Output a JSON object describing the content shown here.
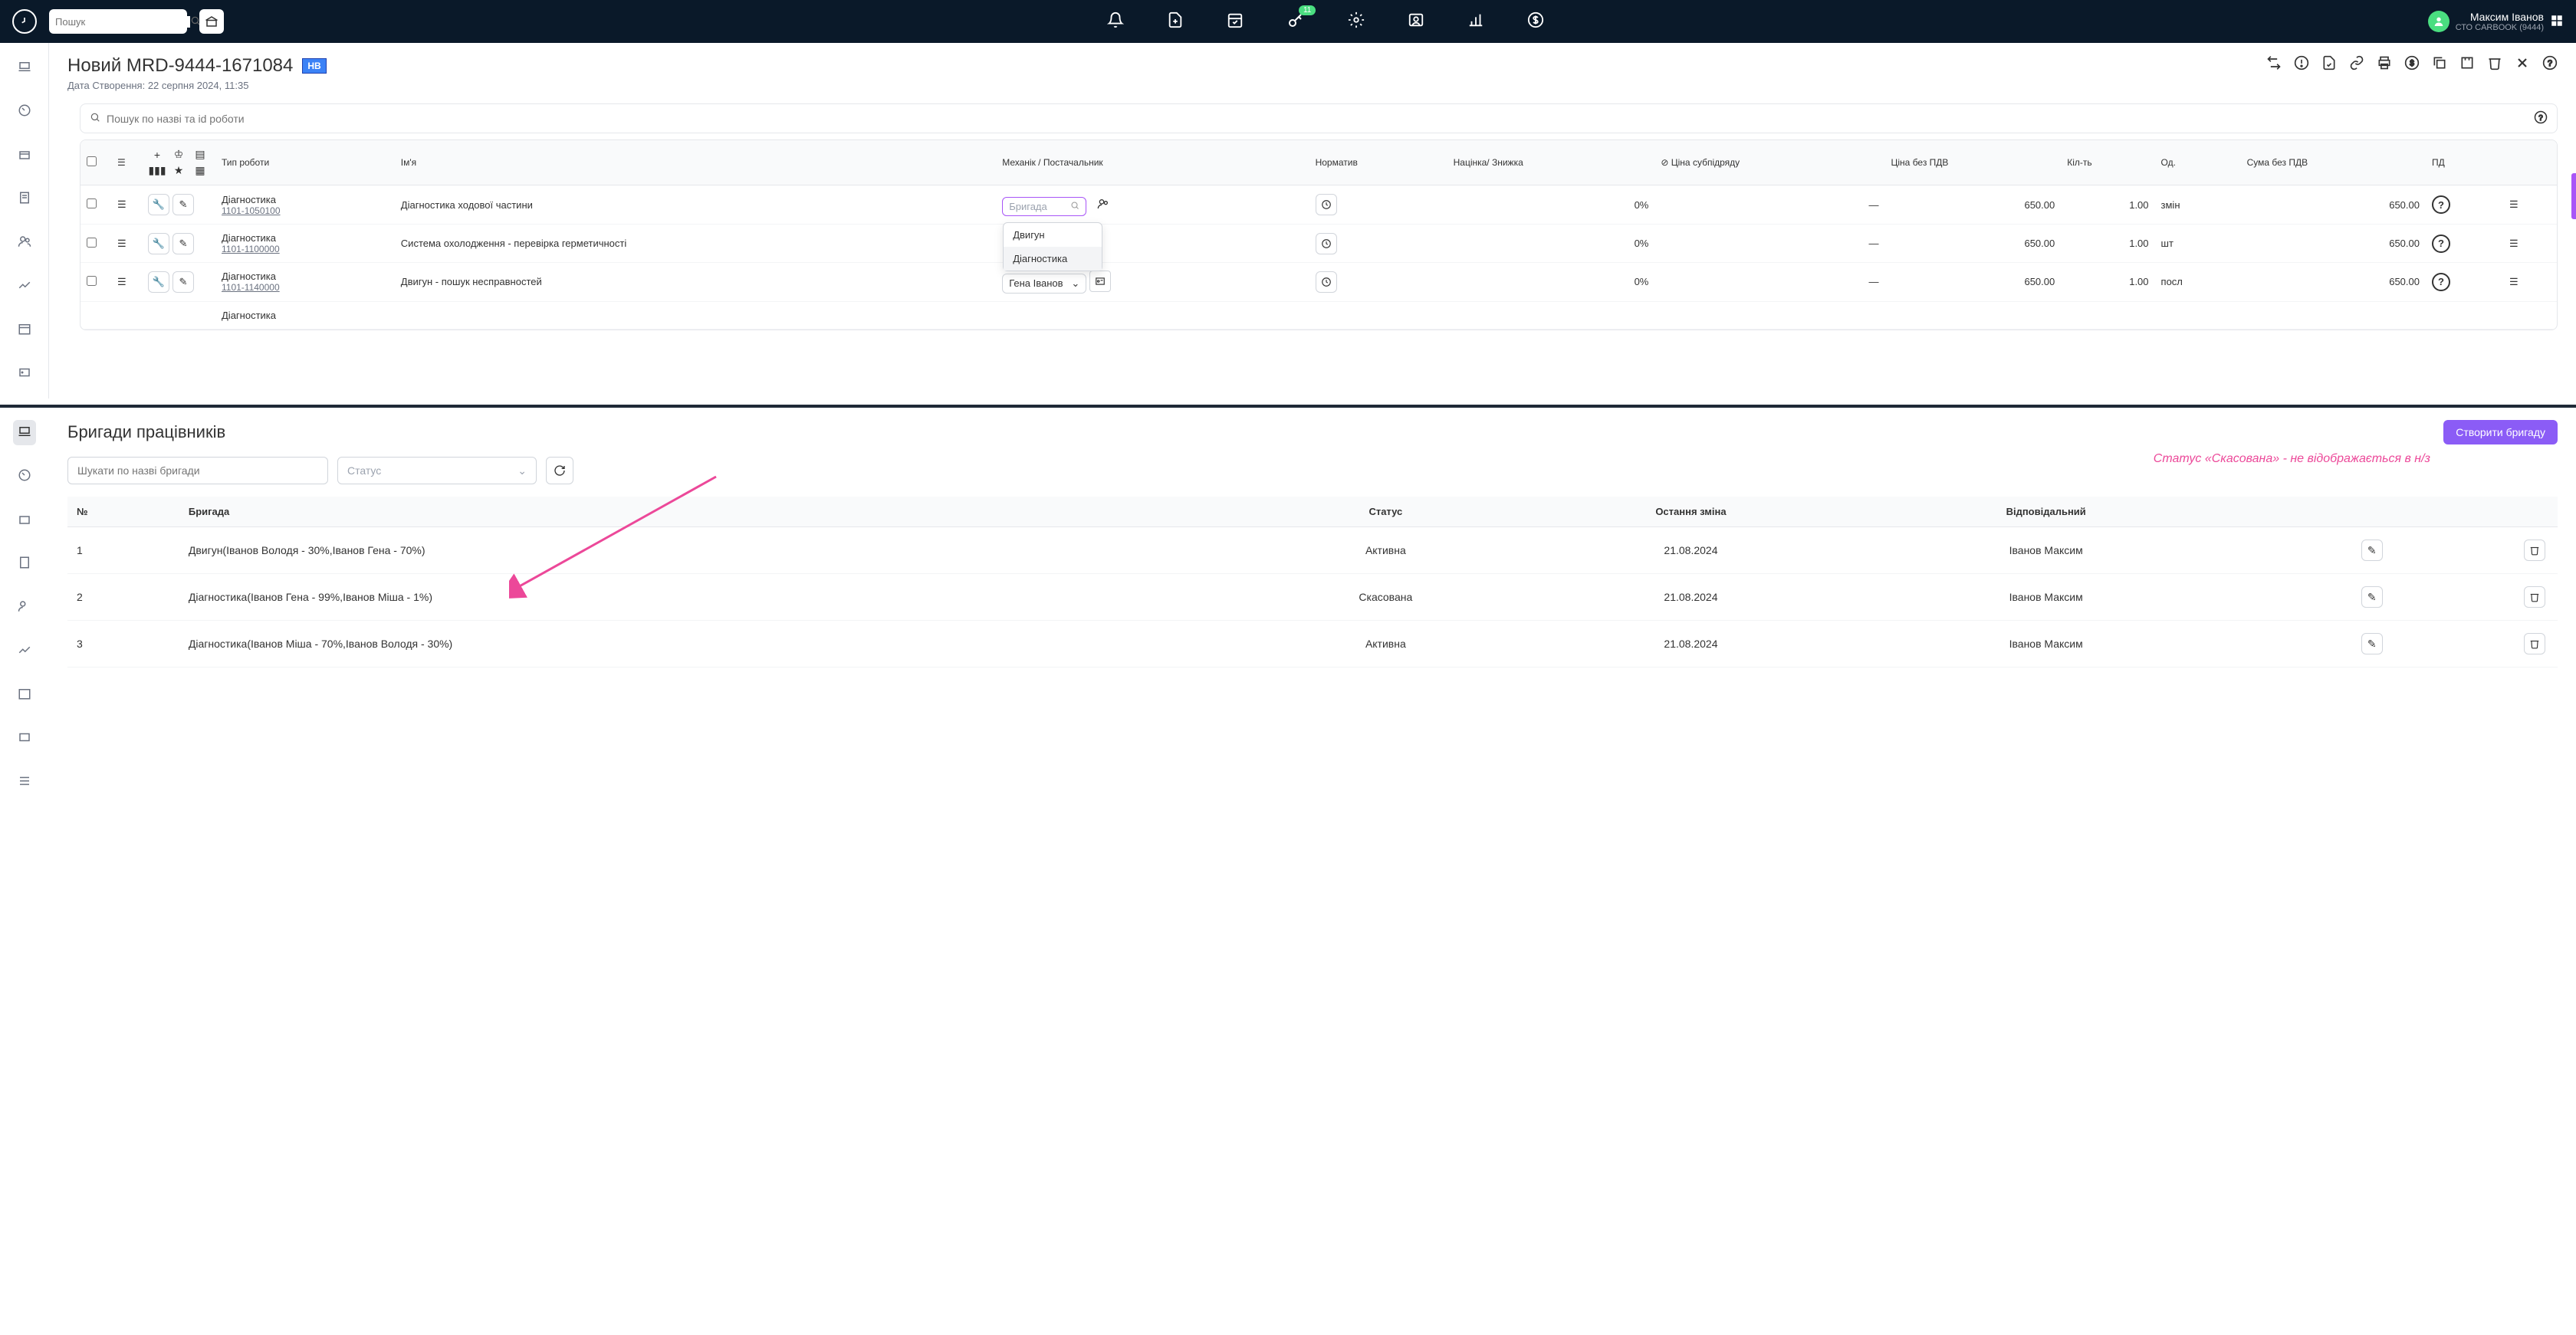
{
  "topbar": {
    "search_placeholder": "Пошук",
    "badge": "11"
  },
  "user": {
    "name": "Максим Іванов",
    "sub": "СТО CARBOOK (9444)"
  },
  "order": {
    "title": "Новий MRD-9444-1671084",
    "badge": "НВ",
    "date_label": "Дата Створення: 22 серпня 2024, 11:35",
    "search_placeholder": "Пошук по назві та id роботи"
  },
  "headers": {
    "type": "Тип роботи",
    "name": "Ім'я",
    "mechanic": "Механік / Постачальник",
    "norm": "Норматив",
    "markup": "Націнка/ Знижка",
    "price_sub": "Ціна субпідряду",
    "price_novat": "Ціна без ПДВ",
    "qty": "Кіл-ть",
    "unit": "Од.",
    "sum_novat": "Сума без ПДВ",
    "pd": "ПД"
  },
  "brigade_placeholder": "Бригада",
  "dropdown": {
    "opt0": "Двигун",
    "opt1": "Діагностика"
  },
  "rows": [
    {
      "type": "Діагностика",
      "code": "1101-1050100",
      "name": "Діагностика ходової частини",
      "mechanic_placeholder": true,
      "markup": "0%",
      "price_sub": "—",
      "price": "650.00",
      "qty": "1.00",
      "unit": "змін",
      "sum": "650.00",
      "icon": "user"
    },
    {
      "type": "Діагностика",
      "code": "1101-1100000",
      "name": "Система охолодження - перевірка герметичності",
      "mechanic": "",
      "markup": "0%",
      "price_sub": "—",
      "price": "650.00",
      "qty": "1.00",
      "unit": "шт",
      "sum": "650.00",
      "icon": "card"
    },
    {
      "type": "Діагностика",
      "code": "1101-1140000",
      "name": "Двигун - пошук несправностей",
      "mechanic": "Гена Іванов",
      "markup": "0%",
      "price_sub": "—",
      "price": "650.00",
      "qty": "1.00",
      "unit": "посл",
      "sum": "650.00",
      "icon": "card"
    },
    {
      "type": "Діагностика",
      "code": "",
      "name": "",
      "mechanic": "",
      "markup": "",
      "price_sub": "",
      "price": "",
      "qty": "",
      "unit": "",
      "sum": "",
      "icon": "card"
    }
  ],
  "bottom": {
    "title": "Бригади працівників",
    "create": "Створити бригаду",
    "search_placeholder": "Шукати по назві бригади",
    "status_placeholder": "Статус",
    "annotation": "Статус «Скасована» - не відображається в н/з",
    "headers": {
      "num": "№",
      "brigade": "Бригада",
      "status": "Статус",
      "last": "Остання зміна",
      "resp": "Відповідальний"
    },
    "rows": [
      {
        "num": "1",
        "name": "Двигун(Іванов Володя - 30%,Іванов Гена - 70%)",
        "status": "Активна",
        "date": "21.08.2024",
        "resp": "Іванов Максим"
      },
      {
        "num": "2",
        "name": "Діагностика(Іванов Гена - 99%,Іванов Міша - 1%)",
        "status": "Скасована",
        "date": "21.08.2024",
        "resp": "Іванов Максим"
      },
      {
        "num": "3",
        "name": "Діагностика(Іванов Міша - 70%,Іванов Володя - 30%)",
        "status": "Активна",
        "date": "21.08.2024",
        "resp": "Іванов Максим"
      }
    ]
  }
}
